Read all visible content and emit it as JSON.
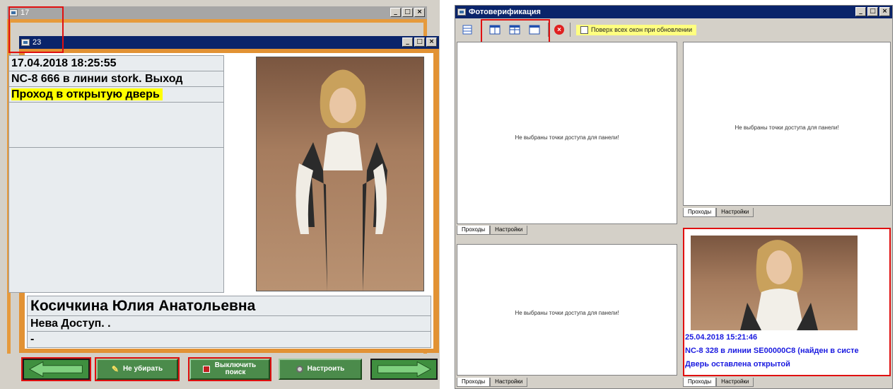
{
  "left": {
    "back_window_title": "17",
    "front_window_title": "23",
    "datetime": "17.04.2018 18:25:55",
    "event_line": "NC-8 666 в линии stork. Выход",
    "event_status": "Проход в открытую дверь",
    "person_name": "Косичкина Юлия  Анатольевна",
    "person_org": "Нева Доступ. .",
    "person_extra": "-",
    "buttons": {
      "keep": "Не убирать",
      "disable_search": "Выключить поиск",
      "configure": "Настроить"
    }
  },
  "right": {
    "window_title": "Фотоверификация",
    "toolbar_checkbox_label": "Поверх всех окон при обновлении",
    "panel_message": "Не выбраны точки доступа для панели!",
    "tabs": {
      "passes": "Проходы",
      "settings": "Настройки"
    },
    "event": {
      "datetime": "25.04.2018 15:21:46",
      "line": "NC-8 328 в линии SE00000C8 (найден в систе",
      "status": "Дверь оставлена открытой"
    }
  },
  "colors": {
    "titlebar_active": "#0a246a",
    "titlebar_inactive": "#a6a6a6",
    "frame_orange": "#e69a3c",
    "highlight_yellow": "#ffff00",
    "button_green": "#4b8b4b",
    "annotation_red": "#e01010",
    "event_blue": "#1a1ae0"
  }
}
